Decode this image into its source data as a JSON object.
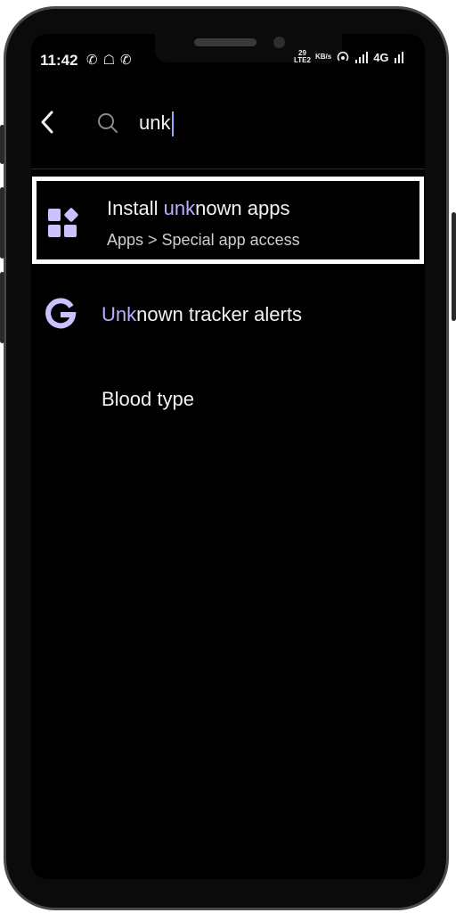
{
  "status_bar": {
    "time": "11:42",
    "left_icons": [
      "whatsapp-icon",
      "snapchat-icon",
      "whatsapp-icon",
      "notification-icon"
    ],
    "lte_label": "LTE2",
    "speed_value": "29",
    "speed_unit": "KB/s",
    "network": "4G"
  },
  "search": {
    "query": "unk",
    "placeholder": ""
  },
  "results": [
    {
      "title_match": "",
      "title_pre": "Install ",
      "title_highlight": "unk",
      "title_post": "nown apps",
      "subtitle": "Apps > Special app access",
      "icon": "apps-grid-icon"
    },
    {
      "title_pre": "",
      "title_highlight": "Unk",
      "title_post": "nown tracker alerts",
      "icon": "google-icon"
    },
    {
      "title_pre": "Blood type",
      "title_highlight": "",
      "title_post": ""
    }
  ],
  "colors": {
    "background": "#000000",
    "text": "#f2f2f2",
    "highlight": "#b9b0ff",
    "icon": "#c9c2ff",
    "selection_border": "#ffffff"
  }
}
